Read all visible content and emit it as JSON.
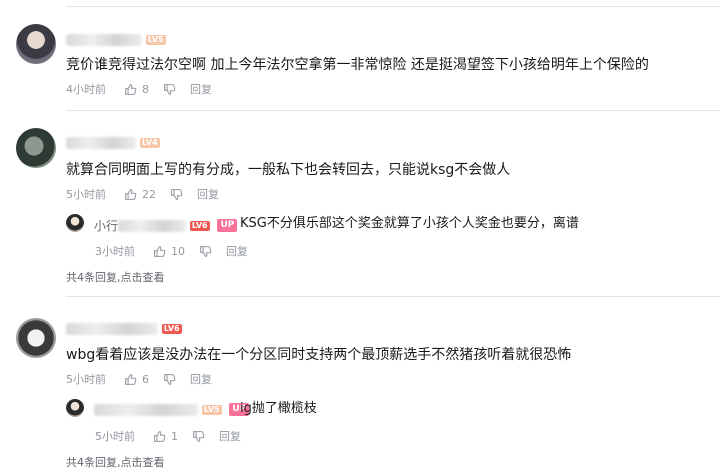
{
  "comments": [
    {
      "username_hidden": true,
      "level": "LV5",
      "content": "竞价谁竞得过法尔空啊 加上今年法尔空拿第一非常惊险 还是挺渴望签下小孩给明年上个保险的",
      "time": "4小时前",
      "likes": "8",
      "reply_label": "回复"
    },
    {
      "username_hidden": true,
      "level": "LV4",
      "content": "就算合同明面上写的有分成，一般私下也会转回去，只能说ksg不会做人",
      "time": "5小时前",
      "likes": "22",
      "reply_label": "回复",
      "sub_reply": {
        "user_prefix": "小行",
        "level": "LV6",
        "badge": "UP",
        "content": "KSG不分俱乐部这个奖金就算了小孩个人奖金也要分，离谱",
        "time": "3小时前",
        "likes": "10",
        "reply_label": "回复"
      },
      "more_count": "共4条回复,",
      "more_link": "点击查看"
    },
    {
      "username_hidden": true,
      "level": "LV6",
      "content": "wbg看着应该是没办法在一个分区同时支持两个最顶薪选手不然猪孩听着就很恐怖",
      "time": "5小时前",
      "likes": "6",
      "reply_label": "回复",
      "sub_reply": {
        "level": "LV5",
        "badge": "UP",
        "content": "ig抛了橄榄枝",
        "time": "5小时前",
        "likes": "1",
        "reply_label": "回复"
      },
      "more_count": "共4条回复,",
      "more_link": "点击查看"
    }
  ],
  "colors": {
    "text": "#18191c",
    "meta": "#9499a0",
    "up_badge": "#fb7299",
    "divider": "#e3e5e7"
  }
}
